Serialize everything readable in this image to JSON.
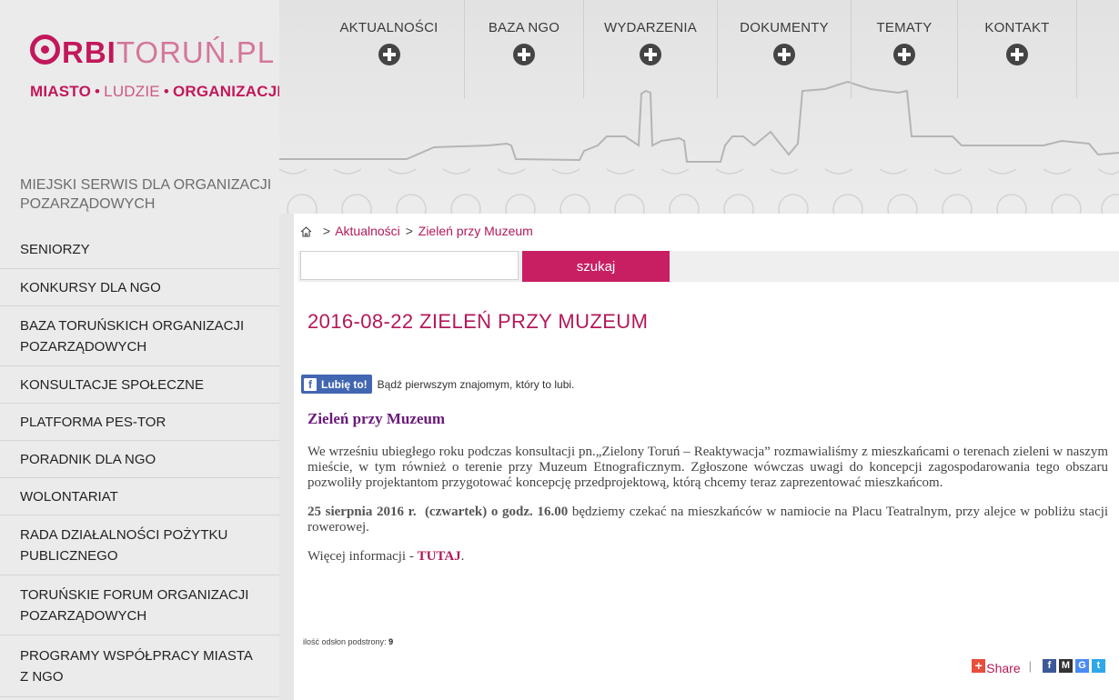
{
  "logo": {
    "rbi": "RBI",
    "rest": "TORUŃ.PL"
  },
  "tagline": {
    "part1": "MIASTO",
    "dot1": "•",
    "part2": "LUDZIE",
    "dot2": "•",
    "part3": "ORGANIZACJE"
  },
  "site_description": "MIEJSKI SERWIS DLA ORGANIZACJI POZARZĄDOWYCH",
  "sidebar": {
    "items": [
      {
        "label": "SENIORZY"
      },
      {
        "label": "KONKURSY DLA NGO"
      },
      {
        "label": "BAZA TORUŃSKICH ORGANIZACJI POZARZĄDOWYCH"
      },
      {
        "label": "KONSULTACJE SPOŁECZNE"
      },
      {
        "label": "PLATFORMA PES-TOR"
      },
      {
        "label": "PORADNIK DLA NGO"
      },
      {
        "label": "WOLONTARIAT"
      },
      {
        "label": "RADA DZIAŁALNOŚCI POŻYTKU PUBLICZNEGO"
      },
      {
        "label": "TORUŃSKIE FORUM ORGANIZACJI POZARZĄDOWYCH"
      },
      {
        "label": "PROGRAMY WSPÓŁPRACY MIASTA Z NGO"
      }
    ]
  },
  "nav": {
    "items": [
      {
        "label": "AKTUALNOŚCI"
      },
      {
        "label": "BAZA NGO"
      },
      {
        "label": "WYDARZENIA"
      },
      {
        "label": "DOKUMENTY"
      },
      {
        "label": "TEMATY"
      },
      {
        "label": "KONTAKT"
      }
    ]
  },
  "breadcrumb": {
    "separator": ">",
    "section": "Aktualności",
    "current": "Zieleń przy Muzeum"
  },
  "search": {
    "value": "",
    "placeholder": "",
    "button_label": "szukaj"
  },
  "page_title": "2016-08-22 ZIELEŃ PRZY MUZEUM",
  "facebook": {
    "button_label": "Lubię to!",
    "text": "Bądź pierwszym znajomym, który to lubi."
  },
  "article": {
    "heading": "Zieleń przy Muzeum",
    "paragraph1": "We wrześniu ubiegłego roku podczas konsultacji pn.„Zielony Toruń – Reaktywacja” rozmawialiśmy z mieszkańcami o terenach zieleni w naszym mieście, w tym również o terenie przy Muzeum Etnograficznym. Zgłoszone wówczas uwagi do koncepcji zagospodarowania tego obszaru pozwoliły projektantom przygotować koncepcję przedprojektową, którą chcemy teraz zaprezentować mieszkańcom.",
    "p2_date": "25 sierpnia 2016 r.",
    "p2_day": "(czwartek)",
    "p2_mid": "o godz.",
    "p2_time": "16.00",
    "p2_rest": "będziemy czekać na mieszkańców w namiocie na Placu Teatralnym, przy alejce w pobliżu stacji rowerowej.",
    "more_text": "Więcej informacji  -",
    "more_link": "TUTAJ",
    "more_end": "."
  },
  "views": {
    "label": "ilość odsłon podstrony:",
    "count": "9"
  },
  "share": {
    "label": "Share",
    "plus": "+",
    "separator": "|"
  },
  "social": {
    "fb": "f",
    "ms": "M",
    "g": "G",
    "tw": "t"
  },
  "colors": {
    "accent": "#c81f63",
    "brand": "#b41859",
    "facebook": "#4267b2"
  }
}
